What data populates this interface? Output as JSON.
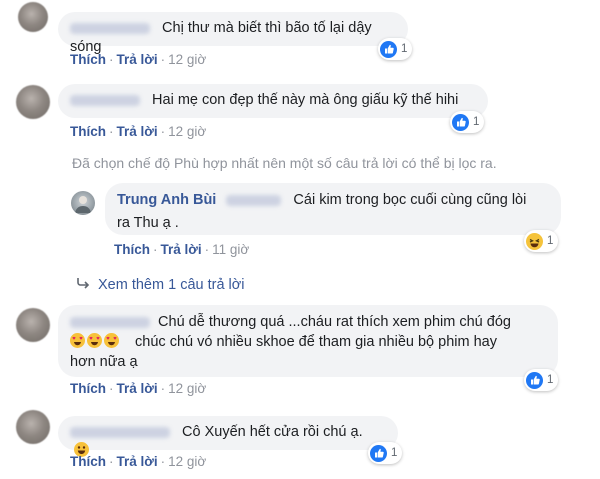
{
  "comments": [
    {
      "text": "Chị thư mà biết thì bão tố lại dậy sóng",
      "actions": {
        "like": "Thích",
        "reply": "Trả lời",
        "time": "12 giờ"
      },
      "reactions": {
        "icon": "like-icon",
        "count": "1"
      }
    },
    {
      "text": "Hai mẹ con đẹp thế này mà ông giấu kỹ thế hihi",
      "actions": {
        "like": "Thích",
        "reply": "Trả lời",
        "time": "12 giờ"
      },
      "reactions": {
        "icon": "like-icon",
        "count": "1"
      }
    },
    {
      "text_line1": "Chú dễ thương quá ...cháu rat thích xem phim chú đóg",
      "text_line2": "chúc chú vó nhiều skhoe để tham gia nhiều bộ phim hay",
      "text_line3": "hơn nữa ạ",
      "emojis": "heart-eyes-emoji x3",
      "actions": {
        "like": "Thích",
        "reply": "Trả lời",
        "time": "12 giờ"
      },
      "reactions": {
        "icon": "like-icon",
        "count": "1"
      }
    },
    {
      "text": "Cô Xuyến hết cửa rồi chú ạ.",
      "emoji": "smile-emoji",
      "actions": {
        "like": "Thích",
        "reply": "Trả lời",
        "time": "12 giờ"
      },
      "reactions": {
        "icon": "like-icon",
        "count": "1"
      }
    }
  ],
  "filter_notice": "Đã chọn chế độ Phù hợp nhất nên một số câu trả lời có thể bị lọc ra.",
  "reply": {
    "author": "Trung Anh Bùi",
    "text_line1": "Cái kim trong bọc cuối cùng cũng lòi",
    "text_line2": "ra Thu ạ .",
    "actions": {
      "like": "Thích",
      "reply": "Trả lời",
      "time": "11 giờ"
    },
    "reactions": {
      "icon": "haha-icon",
      "count": "1"
    }
  },
  "view_more": "Xem thêm 1 câu trả lời",
  "colors": {
    "link": "#385898",
    "bubble": "#f2f3f5",
    "like": "#2078f4",
    "muted": "#90949c"
  }
}
